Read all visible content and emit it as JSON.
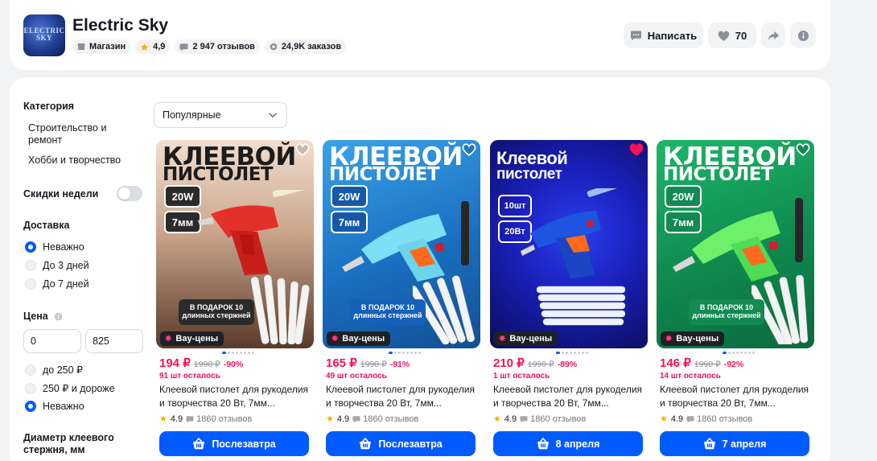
{
  "store": {
    "name": "Electric Sky",
    "logo_text": "ELECTRIC SKY",
    "type": "Магазин",
    "rating": "4,9",
    "reviews": "2 947 отзывов",
    "orders": "24,9K заказов"
  },
  "actions": {
    "write": "Написать",
    "likes": "70"
  },
  "filters": {
    "category_title": "Категория",
    "categories": [
      "Строительство и ремонт",
      "Хобби и творчество"
    ],
    "weekly_discounts": "Скидки недели",
    "weekly_discounts_on": false,
    "delivery_title": "Доставка",
    "delivery_options": [
      "Неважно",
      "До 3 дней",
      "До 7 дней"
    ],
    "delivery_selected": 0,
    "price_title": "Цена",
    "price_min": "0",
    "price_max": "825",
    "price_options": [
      "до 250 ₽",
      "250 ₽ и дороже",
      "Неважно"
    ],
    "price_selected": 2,
    "diameter_title": "Диаметр клеевого стержня, мм"
  },
  "sort": {
    "selected": "Популярные"
  },
  "colors": {
    "accent": "#005bff",
    "price": "#f91155"
  },
  "products": [
    {
      "img_line1": "КЛЕЕВОЙ",
      "img_line2": "ПИСТОЛЕТ",
      "spec_power": "20W",
      "spec_diam": "7мм",
      "gift": "В ПОДАРОК 10 длинных стержней",
      "badge": "Вау-цены",
      "price": "194 ₽",
      "old_price": "1990 ₽",
      "discount": "-90%",
      "stock": "91 шт осталось",
      "title": "Клеевой пистолет для рукоделия и творчества 20 Вт, 7мм...",
      "rating": "4.9",
      "reviews": "1860 отзывов",
      "delivery": "Послезавтра",
      "liked": false
    },
    {
      "img_line1": "КЛЕЕВОЙ",
      "img_line2": "ПИСТОЛЕТ",
      "spec_power": "20W",
      "spec_diam": "7мм",
      "gift": "В ПОДАРОК 10 длинных стержней",
      "badge": "Вау-цены",
      "price": "165 ₽",
      "old_price": "1990 ₽",
      "discount": "-91%",
      "stock": "49 шт осталось",
      "title": "Клеевой пистолет для рукоделия и творчества 20 Вт, 7мм...",
      "rating": "4.9",
      "reviews": "1860 отзывов",
      "delivery": "Послезавтра",
      "liked": false
    },
    {
      "img_line1": "Клеевой",
      "img_line2": "пистолет",
      "spec_power": "10шт",
      "spec_diam": "20Вт",
      "gift": "",
      "badge": "Вау-цены",
      "price": "210 ₽",
      "old_price": "1990 ₽",
      "discount": "-89%",
      "stock": "1 шт осталось",
      "title": "Клеевой пистолет для рукоделия и творчества 20 Вт, 7мм...",
      "rating": "4.9",
      "reviews": "1860 отзывов",
      "delivery": "8 апреля",
      "liked": true
    },
    {
      "img_line1": "КЛЕЕВОЙ",
      "img_line2": "ПИСТОЛЕТ",
      "spec_power": "20W",
      "spec_diam": "7мм",
      "gift": "В ПОДАРОК 10 длинных стержней",
      "badge": "Вау-цены",
      "price": "146 ₽",
      "old_price": "1990 ₽",
      "discount": "-92%",
      "stock": "14 шт осталось",
      "title": "Клеевой пистолет для рукоделия и творчества 20 Вт, 7мм...",
      "rating": "4.9",
      "reviews": "1860 отзывов",
      "delivery": "7 апреля",
      "liked": false
    }
  ]
}
